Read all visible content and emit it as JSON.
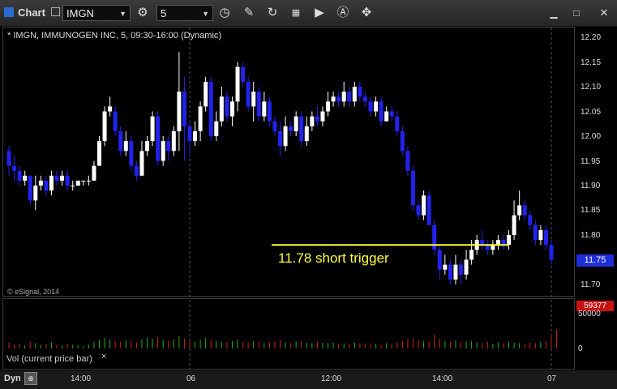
{
  "window": {
    "title": "Chart"
  },
  "toolbar": {
    "symbol": "IMGN",
    "interval": "5",
    "icons": [
      "gear-icon",
      "clock-icon",
      "pencil-icon",
      "refresh-icon",
      "chart-type-icon",
      "play-icon",
      "alert-icon",
      "cursor-icon"
    ],
    "window_controls": [
      "minimize",
      "maximize",
      "close"
    ]
  },
  "chart_header": "* IMGN, IMMUNOGEN INC, 5, 09:30-16:00 (Dynamic)",
  "copyright": "© eSignal, 2014",
  "annotation": {
    "label": "11.78 short trigger",
    "price": 11.78,
    "color": "#ffff33"
  },
  "price_axis": {
    "labels": [
      "12.20",
      "12.15",
      "12.10",
      "12.05",
      "12.00",
      "11.95",
      "11.90",
      "11.85",
      "11.80",
      "11.75",
      "11.70"
    ],
    "current_price": "11.75"
  },
  "volume": {
    "caption": "Vol (current price bar)",
    "close_symbol": "×",
    "last_value": "59377",
    "axis_labels": [
      "50000",
      "0"
    ]
  },
  "time_axis": {
    "labels": [
      "14:00",
      "06",
      "12:00",
      "14:00",
      "07"
    ]
  },
  "bottom": {
    "mode": "Dyn"
  },
  "colors": {
    "up": "#ffffff",
    "down": "#2222ee",
    "trigger": "#ffff33",
    "volume_up": "#22aa22",
    "volume_down": "#cc2222"
  },
  "chart_data": {
    "type": "candlestick",
    "ylim": [
      11.68,
      12.22
    ],
    "x_labels": [
      "14:00",
      "06",
      "12:00",
      "14:00",
      "07"
    ],
    "y_labels": [
      "12.20",
      "12.15",
      "12.10",
      "12.05",
      "12.00",
      "11.95",
      "11.90",
      "11.85",
      "11.80",
      "11.75",
      "11.70"
    ],
    "trigger_line": 11.78,
    "candles": [
      [
        11.97,
        11.94,
        11.98,
        11.92
      ],
      [
        11.94,
        11.93,
        11.96,
        11.91
      ],
      [
        11.93,
        11.91,
        11.94,
        11.9
      ],
      [
        11.91,
        11.92,
        11.93,
        11.9
      ],
      [
        11.92,
        11.87,
        11.92,
        11.86
      ],
      [
        11.87,
        11.9,
        11.92,
        11.85
      ],
      [
        11.9,
        11.91,
        11.92,
        11.89
      ],
      [
        11.91,
        11.89,
        11.92,
        11.88
      ],
      [
        11.89,
        11.92,
        11.93,
        11.88
      ],
      [
        11.92,
        11.91,
        11.93,
        11.9
      ],
      [
        11.91,
        11.92,
        11.93,
        11.9
      ],
      [
        11.92,
        11.9,
        11.93,
        11.89
      ],
      [
        11.9,
        11.9,
        11.91,
        11.89
      ],
      [
        11.9,
        11.91,
        11.91,
        11.9
      ],
      [
        11.91,
        11.91,
        11.91,
        11.9
      ],
      [
        11.91,
        11.91,
        11.92,
        11.9
      ],
      [
        11.91,
        11.94,
        11.95,
        11.91
      ],
      [
        11.94,
        11.99,
        12.0,
        11.94
      ],
      [
        11.99,
        12.05,
        12.06,
        11.98
      ],
      [
        12.05,
        12.06,
        12.08,
        12.04
      ],
      [
        12.05,
        12.01,
        12.06,
        12.0
      ],
      [
        12.01,
        11.97,
        12.02,
        11.96
      ],
      [
        11.97,
        11.99,
        12.01,
        11.96
      ],
      [
        11.99,
        11.94,
        12.0,
        11.93
      ],
      [
        11.94,
        11.92,
        11.95,
        11.91
      ],
      [
        11.92,
        11.97,
        11.99,
        11.92
      ],
      [
        11.97,
        11.99,
        12.0,
        11.96
      ],
      [
        11.99,
        12.04,
        12.05,
        11.98
      ],
      [
        12.04,
        11.95,
        12.05,
        11.94
      ],
      [
        11.95,
        11.99,
        12.0,
        11.94
      ],
      [
        11.99,
        11.97,
        12.0,
        11.95
      ],
      [
        11.97,
        12.01,
        12.02,
        11.96
      ],
      [
        12.01,
        12.09,
        12.17,
        11.97
      ],
      [
        12.09,
        12.02,
        12.12,
        11.95
      ],
      [
        12.02,
        11.99,
        12.03,
        11.96
      ],
      [
        11.99,
        12.01,
        12.03,
        11.98
      ],
      [
        12.01,
        12.06,
        12.07,
        11.99
      ],
      [
        12.06,
        12.11,
        12.12,
        12.05
      ],
      [
        12.11,
        12.0,
        12.12,
        11.99
      ],
      [
        12.0,
        12.03,
        12.05,
        11.99
      ],
      [
        12.03,
        12.08,
        12.1,
        12.02
      ],
      [
        12.08,
        12.04,
        12.09,
        12.03
      ],
      [
        12.04,
        12.07,
        12.08,
        12.02
      ],
      [
        12.07,
        12.14,
        12.15,
        12.05
      ],
      [
        12.14,
        12.11,
        12.15,
        12.1
      ],
      [
        12.11,
        12.06,
        12.12,
        12.05
      ],
      [
        12.06,
        12.09,
        12.11,
        12.03
      ],
      [
        12.09,
        12.04,
        12.1,
        12.03
      ],
      [
        12.04,
        12.07,
        12.09,
        12.03
      ],
      [
        12.07,
        12.03,
        12.08,
        12.02
      ],
      [
        12.03,
        12.01,
        12.04,
        12.0
      ],
      [
        12.01,
        11.98,
        12.03,
        11.96
      ],
      [
        11.98,
        12.02,
        12.04,
        11.97
      ],
      [
        12.02,
        12.01,
        12.03,
        12.0
      ],
      [
        12.01,
        12.04,
        12.05,
        12.0
      ],
      [
        12.04,
        11.99,
        12.05,
        11.98
      ],
      [
        11.99,
        12.02,
        12.04,
        11.98
      ],
      [
        12.02,
        12.04,
        12.05,
        12.01
      ],
      [
        12.04,
        12.03,
        12.06,
        12.02
      ],
      [
        12.03,
        12.05,
        12.06,
        12.02
      ],
      [
        12.05,
        12.07,
        12.09,
        12.04
      ],
      [
        12.07,
        12.08,
        12.09,
        12.06
      ],
      [
        12.08,
        12.07,
        12.09,
        12.06
      ],
      [
        12.07,
        12.09,
        12.11,
        12.06
      ],
      [
        12.09,
        12.07,
        12.1,
        12.06
      ],
      [
        12.07,
        12.1,
        12.11,
        12.06
      ],
      [
        12.1,
        12.08,
        12.11,
        12.07
      ],
      [
        12.08,
        12.07,
        12.09,
        12.06
      ],
      [
        12.07,
        12.05,
        12.08,
        12.04
      ],
      [
        12.05,
        12.07,
        12.08,
        12.04
      ],
      [
        12.07,
        12.03,
        12.08,
        12.02
      ],
      [
        12.03,
        12.05,
        12.06,
        12.03
      ],
      [
        12.05,
        12.04,
        12.06,
        12.03
      ],
      [
        12.04,
        12.01,
        12.05,
        12.0
      ],
      [
        12.01,
        11.97,
        12.02,
        11.96
      ],
      [
        11.97,
        11.93,
        11.98,
        11.92
      ],
      [
        11.93,
        11.86,
        11.94,
        11.85
      ],
      [
        11.86,
        11.84,
        11.87,
        11.83
      ],
      [
        11.84,
        11.88,
        11.89,
        11.83
      ],
      [
        11.88,
        11.82,
        11.89,
        11.82
      ],
      [
        11.82,
        11.77,
        11.83,
        11.76
      ],
      [
        11.77,
        11.73,
        11.78,
        11.71
      ],
      [
        11.73,
        11.74,
        11.76,
        11.72
      ],
      [
        11.74,
        11.71,
        11.75,
        11.7
      ],
      [
        11.71,
        11.74,
        11.76,
        11.7
      ],
      [
        11.74,
        11.72,
        11.75,
        11.7
      ],
      [
        11.72,
        11.75,
        11.77,
        11.71
      ],
      [
        11.75,
        11.77,
        11.79,
        11.74
      ],
      [
        11.77,
        11.79,
        11.8,
        11.76
      ],
      [
        11.79,
        11.78,
        11.81,
        11.77
      ],
      [
        11.78,
        11.77,
        11.79,
        11.76
      ],
      [
        11.77,
        11.78,
        11.79,
        11.76
      ],
      [
        11.78,
        11.79,
        11.8,
        11.77
      ],
      [
        11.79,
        11.78,
        11.8,
        11.77
      ],
      [
        11.78,
        11.8,
        11.81,
        11.77
      ],
      [
        11.8,
        11.84,
        11.87,
        11.79
      ],
      [
        11.84,
        11.86,
        11.89,
        11.83
      ],
      [
        11.86,
        11.84,
        11.87,
        11.83
      ],
      [
        11.84,
        11.82,
        11.85,
        11.81
      ],
      [
        11.82,
        11.79,
        11.83,
        11.78
      ],
      [
        11.79,
        11.81,
        11.82,
        11.78
      ],
      [
        11.81,
        11.78,
        11.82,
        11.77
      ],
      [
        11.78,
        11.75,
        11.79,
        11.74
      ]
    ],
    "volumes": [
      8,
      5,
      6,
      4,
      9,
      7,
      5,
      6,
      8,
      5,
      4,
      6,
      5,
      4,
      3,
      5,
      9,
      11,
      14,
      12,
      10,
      9,
      11,
      10,
      8,
      12,
      14,
      13,
      15,
      11,
      10,
      12,
      16,
      13,
      10,
      9,
      12,
      14,
      11,
      10,
      9,
      8,
      10,
      12,
      9,
      8,
      10,
      9,
      7,
      8,
      9,
      11,
      8,
      7,
      9,
      10,
      8,
      7,
      9,
      8,
      7,
      8,
      6,
      7,
      6,
      8,
      7,
      6,
      7,
      6,
      5,
      7,
      6,
      8,
      10,
      12,
      14,
      11,
      10,
      9,
      18,
      13,
      10,
      9,
      11,
      8,
      9,
      10,
      8,
      7,
      9,
      6,
      8,
      7,
      9,
      8,
      7,
      6,
      8,
      7,
      9,
      10,
      16,
      25
    ]
  }
}
